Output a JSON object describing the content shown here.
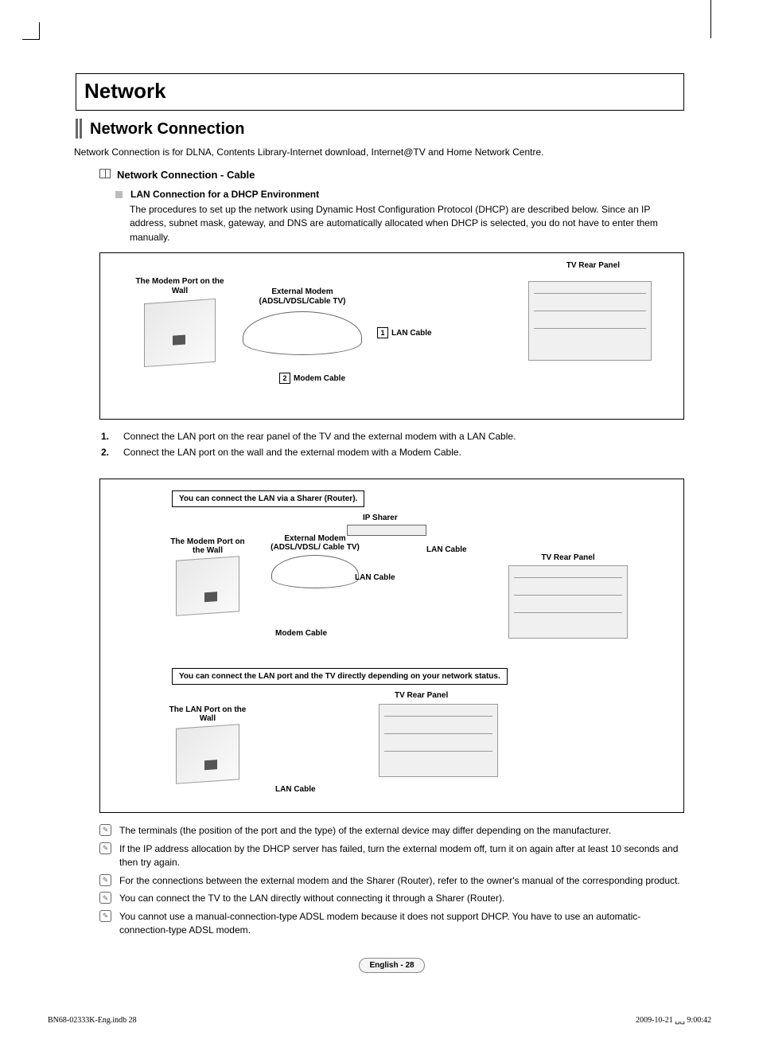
{
  "title": "Network",
  "section": "Network Connection",
  "intro": "Network Connection is for DLNA, Contents Library-Internet download, Internet@TV and Home Network Centre.",
  "sub_heading": "Network Connection - Cable",
  "lan_heading": "LAN Connection for a DHCP Environment",
  "lan_body": "The procedures to set up the network using Dynamic Host Configuration Protocol (DHCP) are described below. Since an IP address, subnet mask, gateway, and DNS are automatically allocated when DHCP is selected, you do not have to enter them manually.",
  "diagram1": {
    "tv_label": "TV Rear Panel",
    "wall_label": "The Modem Port on the Wall",
    "modem_label": "External Modem (ADSL/VDSL/Cable TV)",
    "lan_num": "1",
    "lan_cable": "LAN Cable",
    "modem_num": "2",
    "modem_cable": "Modem Cable"
  },
  "steps": [
    "Connect the LAN port on the rear panel of the TV and the external modem with a LAN Cable.",
    "Connect the LAN port on the wall and the external modem with a Modem Cable."
  ],
  "diagram2": {
    "banner1": "You can connect the LAN via a Sharer (Router).",
    "ip_sharer": "IP Sharer",
    "wall_label": "The Modem Port on the Wall",
    "modem_label": "External Modem (ADSL/VDSL/ Cable TV)",
    "lan_cable": "LAN Cable",
    "tv_label": "TV Rear Panel",
    "modem_cable": "Modem Cable",
    "banner2": "You can connect the LAN port and the TV directly depending on your network status.",
    "wall_label2": "The LAN Port on the Wall"
  },
  "notes": [
    "The terminals (the position of the port and the type) of the external device may differ depending on the manufacturer.",
    "If the IP address allocation by the DHCP server has failed, turn the external modem off, turn it on again after at least 10 seconds and then try again.",
    "For the connections between the external modem and the Sharer (Router), refer to the owner's manual of the corresponding product.",
    "You can connect the TV to the LAN directly without connecting it through a Sharer (Router).",
    "You cannot use a manual-connection-type ADSL modem because it does not support DHCP. You have to use an automatic-connection-type ADSL modem."
  ],
  "page_pill": "English - 28",
  "footer_left": "BN68-02333K-Eng.indb   28",
  "footer_right": "2009-10-21   ␣␣ 9:00:42"
}
